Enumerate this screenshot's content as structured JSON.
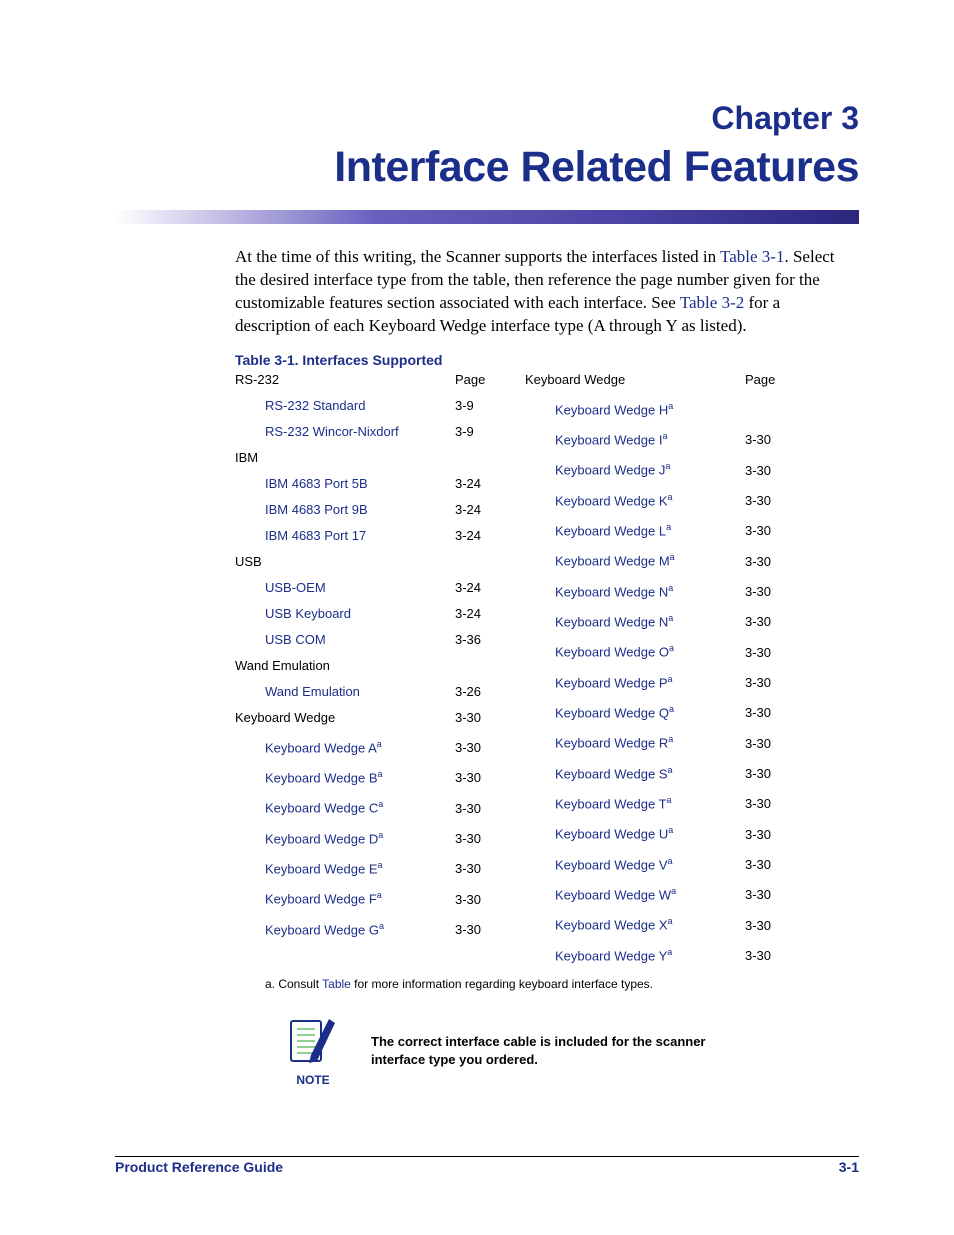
{
  "chapter": {
    "number_label": "Chapter 3",
    "title": "Interface Related Features"
  },
  "intro": {
    "p1a": "At the time of this writing, the Scanner supports the interfaces listed in ",
    "ref1": "Table 3-1",
    "p1b": ". Select the desired interface type from the table, then reference the page number given for the customizable features section associated with each interface. See ",
    "ref2": "Table 3-2",
    "p1c": " for a description of each Keyboard Wedge interface type (A through Y as listed)."
  },
  "table_caption": "Table 3-1. Interfaces Supported",
  "left": {
    "head_left": "RS-232",
    "head_right": "Page",
    "rows": [
      {
        "type": "item",
        "label": "RS-232 Standard",
        "page": "3-9"
      },
      {
        "type": "item",
        "label": "RS-232 Wincor-Nixdorf",
        "page": "3-9"
      },
      {
        "type": "group",
        "label": "IBM",
        "page": ""
      },
      {
        "type": "item",
        "label": "IBM 4683 Port 5B",
        "page": "3-24"
      },
      {
        "type": "item",
        "label": "IBM 4683 Port 9B",
        "page": "3-24"
      },
      {
        "type": "item",
        "label": "IBM 4683 Port 17",
        "page": "3-24"
      },
      {
        "type": "group",
        "label": "USB",
        "page": ""
      },
      {
        "type": "item",
        "label": "USB-OEM",
        "page": "3-24"
      },
      {
        "type": "item",
        "label": "USB Keyboard",
        "page": "3-24"
      },
      {
        "type": "item",
        "label": "USB COM",
        "page": "3-36"
      },
      {
        "type": "group",
        "label": "Wand Emulation",
        "page": ""
      },
      {
        "type": "item",
        "label": "Wand Emulation",
        "page": "3-26"
      },
      {
        "type": "group",
        "label": "Keyboard Wedge",
        "page": "3-30"
      },
      {
        "type": "item",
        "label": "Keyboard Wedge A",
        "sup": "a",
        "page": "3-30"
      },
      {
        "type": "item",
        "label": "Keyboard Wedge B",
        "sup": "a",
        "page": "3-30"
      },
      {
        "type": "item",
        "label": "Keyboard Wedge C",
        "sup": "a",
        "page": "3-30"
      },
      {
        "type": "item",
        "label": "Keyboard Wedge D",
        "sup": "a",
        "page": "3-30"
      },
      {
        "type": "item",
        "label": "Keyboard Wedge E",
        "sup": "a",
        "page": "3-30"
      },
      {
        "type": "item",
        "label": "Keyboard Wedge F",
        "sup": "a",
        "page": "3-30"
      },
      {
        "type": "item",
        "label": "Keyboard Wedge G",
        "sup": "a",
        "page": "3-30"
      }
    ]
  },
  "right": {
    "head_left": "Keyboard Wedge",
    "head_right": "Page",
    "rows": [
      {
        "type": "item",
        "label": "Keyboard Wedge H",
        "sup": "a",
        "page": ""
      },
      {
        "type": "item",
        "label": "Keyboard Wedge I",
        "sup": "a",
        "page": "3-30"
      },
      {
        "type": "item",
        "label": "Keyboard Wedge J",
        "sup": "a",
        "page": "3-30"
      },
      {
        "type": "item",
        "label": "Keyboard Wedge K",
        "sup": "a",
        "page": "3-30"
      },
      {
        "type": "item",
        "label": "Keyboard Wedge L",
        "sup": "a",
        "page": "3-30"
      },
      {
        "type": "item",
        "label": "Keyboard Wedge M",
        "sup": "a",
        "page": "3-30"
      },
      {
        "type": "item",
        "label": "Keyboard Wedge N",
        "sup": "a",
        "page": "3-30"
      },
      {
        "type": "item",
        "label": "Keyboard Wedge N",
        "sup": "a",
        "page": "3-30"
      },
      {
        "type": "item",
        "label": "Keyboard Wedge O",
        "sup": "a",
        "page": "3-30"
      },
      {
        "type": "item",
        "label": "Keyboard Wedge P",
        "sup": "a",
        "page": "3-30"
      },
      {
        "type": "item",
        "label": "Keyboard Wedge Q",
        "sup": "a",
        "page": "3-30"
      },
      {
        "type": "item",
        "label": "Keyboard Wedge R",
        "sup": "a",
        "page": "3-30"
      },
      {
        "type": "item",
        "label": "Keyboard Wedge S",
        "sup": "a",
        "page": "3-30"
      },
      {
        "type": "item",
        "label": "Keyboard Wedge T",
        "sup": "a",
        "page": "3-30"
      },
      {
        "type": "item",
        "label": "Keyboard Wedge U",
        "sup": "a",
        "page": "3-30"
      },
      {
        "type": "item",
        "label": "Keyboard Wedge V",
        "sup": "a",
        "page": "3-30"
      },
      {
        "type": "item",
        "label": "Keyboard Wedge W",
        "sup": "a",
        "page": "3-30"
      },
      {
        "type": "item",
        "label": "Keyboard Wedge X",
        "sup": "a",
        "page": "3-30"
      },
      {
        "type": "item",
        "label": "Keyboard Wedge Y",
        "sup": "a",
        "page": "3-30"
      }
    ]
  },
  "footnote": {
    "prefix": "a.  Consult ",
    "link": "Table",
    "suffix": "  for more information regarding keyboard  interface  types."
  },
  "note": {
    "label": "NOTE",
    "text": "The correct interface cable is included for the scanner interface type you ordered."
  },
  "footer": {
    "left": "Product Reference Guide",
    "right": "3-1"
  }
}
